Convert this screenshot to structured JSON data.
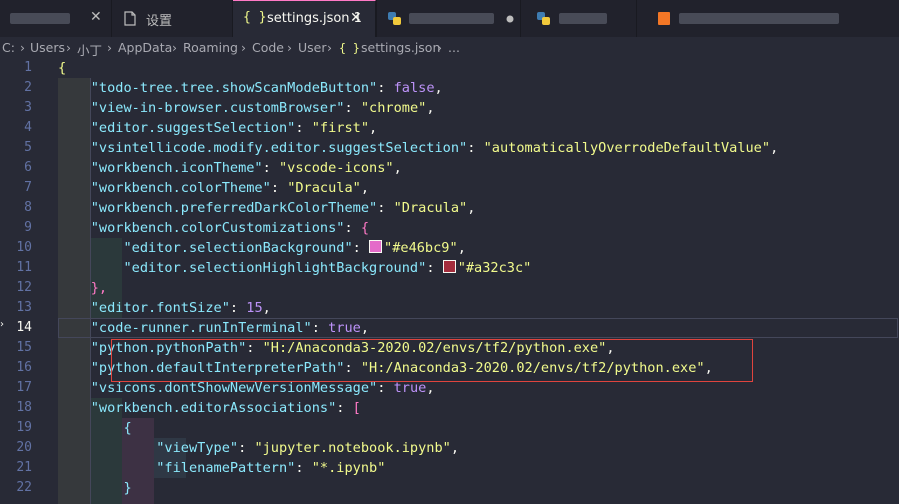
{
  "tabs": [
    {
      "label": "",
      "blurred": true
    },
    {
      "label": "设置",
      "icon": "document-icon"
    },
    {
      "label": "settings.json 1",
      "icon": "json-icon",
      "active": true
    },
    {
      "label": "",
      "blurred": true,
      "icon": "python-icon"
    },
    {
      "label": "",
      "blurred": true,
      "icon": "python-icon"
    },
    {
      "label": "",
      "blurred": true,
      "icon": "notebook-icon"
    }
  ],
  "breadcrumb": {
    "parts": [
      "C:",
      "Users",
      "小丁",
      "AppData",
      "Roaming",
      "Code",
      "User"
    ],
    "file": "settings.json",
    "trail": "..."
  },
  "colors": {
    "selectionBackground": "#e46bc9",
    "selectionHighlightBackground": "#a32c3c",
    "highlightBox": "#e0443e"
  },
  "lines": {
    "numbers": [
      "1",
      "2",
      "3",
      "4",
      "5",
      "6",
      "7",
      "8",
      "9",
      "10",
      "11",
      "12",
      "13",
      "14",
      "15",
      "16",
      "17",
      "18",
      "19",
      "20",
      "21",
      "22"
    ],
    "current": "14",
    "l1": "{",
    "l2": {
      "key": "\"todo-tree.tree.showScanModeButton\"",
      "value": "false"
    },
    "l3": {
      "key": "\"view-in-browser.customBrowser\"",
      "value": "\"chrome\""
    },
    "l4": {
      "key": "\"editor.suggestSelection\"",
      "value": "\"first\""
    },
    "l5": {
      "key": "\"vsintellicode.modify.editor.suggestSelection\"",
      "value": "\"automaticallyOverrodeDefaultValue\""
    },
    "l6": {
      "key": "\"workbench.iconTheme\"",
      "value": "\"vscode-icons\""
    },
    "l7": {
      "key": "\"workbench.colorTheme\"",
      "value": "\"Dracula\""
    },
    "l8": {
      "key": "\"workbench.preferredDarkColorTheme\"",
      "value": "\"Dracula\""
    },
    "l9": {
      "key": "\"workbench.colorCustomizations\"",
      "value": "{"
    },
    "l10": {
      "key": "\"editor.selectionBackground\"",
      "value": "\"#e46bc9\""
    },
    "l11": {
      "key": "\"editor.selectionHighlightBackground\"",
      "value": "\"#a32c3c\""
    },
    "l12": "},",
    "l13": {
      "key": "\"editor.fontSize\"",
      "value": "15"
    },
    "l14": {
      "key": "\"code-runner.runInTerminal\"",
      "value": "true"
    },
    "l15": {
      "key": "\"python.pythonPath\"",
      "value": "\"H:/Anaconda3-2020.02/envs/tf2/python.exe\""
    },
    "l16": {
      "key": "\"python.defaultInterpreterPath\"",
      "value": "\"H:/Anaconda3-2020.02/envs/tf2/python.exe\""
    },
    "l17": {
      "key": "\"vsicons.dontShowNewVersionMessage\"",
      "value": "true"
    },
    "l18": {
      "key": "\"workbench.editorAssociations\"",
      "value": "["
    },
    "l19": "{",
    "l20": {
      "key": "\"viewType\"",
      "value": "\"jupyter.notebook.ipynb\""
    },
    "l21": {
      "key": "\"filenamePattern\"",
      "value": "\"*.ipynb\""
    },
    "l22": "}"
  }
}
